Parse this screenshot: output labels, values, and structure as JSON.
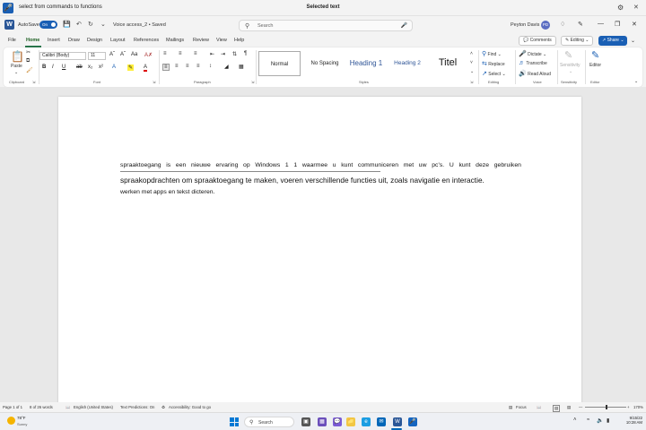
{
  "voice_bar": {
    "command_text": "select from commands to functions",
    "status_text": "Selected text"
  },
  "titlebar": {
    "autosave_label": "AutoSave",
    "toggle_state": "On",
    "doc_title": "Voice access_2 • Saved",
    "search_placeholder": "Search",
    "user_name": "Peyton Davis",
    "user_initials": "PD"
  },
  "tabs": [
    "File",
    "Home",
    "Insert",
    "Draw",
    "Design",
    "Layout",
    "References",
    "Mailings",
    "Review",
    "View",
    "Help"
  ],
  "active_tab": "Home",
  "tab_actions": {
    "comments": "Comments",
    "editing": "Editing",
    "share": "Share"
  },
  "ribbon": {
    "clipboard": {
      "paste": "Paste",
      "label": "Clipboard"
    },
    "font": {
      "name": "Calibri (Body)",
      "size": "11",
      "label": "Font"
    },
    "paragraph": {
      "label": "Paragraph"
    },
    "styles": {
      "items": [
        "Normal",
        "No Spacing",
        "Heading 1",
        "Heading 2",
        "Titel"
      ],
      "label": "Styles"
    },
    "editing": {
      "find": "Find",
      "replace": "Replace",
      "select": "Select",
      "label": "Editing"
    },
    "voice": {
      "dictate": "Dictate",
      "transcribe": "Transcribe",
      "read_aloud": "Read Aloud",
      "label": "Voice"
    },
    "sensitivity": {
      "button": "Sensitivity",
      "label": "Sensitivity"
    },
    "editor": {
      "button": "Editor",
      "label": "Editor"
    }
  },
  "document": {
    "line1": "spraaktoegang is een nieuwe ervaring op Windows 1 1 waarmee u kunt communiceren met uw pc's. U kunt deze gebruiken",
    "line2": "spraakopdrachten om spraaktoegang te maken, voeren verschillende functies uit, zoals navigatie en interactie.",
    "line3": "werken met apps en tekst dicteren."
  },
  "statusbar": {
    "page": "Page 1 of 1",
    "words": "8 of 26 words",
    "language": "English (United States)",
    "predictions": "Text Predictions: On",
    "accessibility": "Accessibility: Good to go",
    "focus": "Focus",
    "zoom": "170%"
  },
  "taskbar": {
    "temp": "78°F",
    "weather": "Sunny",
    "search": "Search",
    "date": "9/15/22",
    "time": "10:28 AM"
  },
  "colors": {
    "word_blue": "#2b5797",
    "accent": "#1a5fb4",
    "home_green": "#1d6f42"
  }
}
